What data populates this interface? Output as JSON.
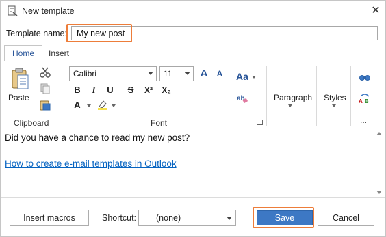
{
  "window": {
    "title": "New template",
    "close_glyph": "✕"
  },
  "template_name": {
    "label": "Template name:",
    "value": "My new post"
  },
  "tabs": [
    {
      "label": "Home",
      "active": true
    },
    {
      "label": "Insert",
      "active": false
    }
  ],
  "ribbon": {
    "clipboard": {
      "paste_label": "Paste",
      "group_label": "Clipboard"
    },
    "font": {
      "font_name": "Calibri",
      "font_size": "11",
      "group_label": "Font",
      "bold": "B",
      "italic": "I",
      "underline": "U",
      "strike": "S",
      "superscript": "X²",
      "subscript": "X₂",
      "font_color_glyph": "A",
      "case_glyph": "Aa",
      "grow_glyph": "A",
      "shrink_glyph": "A"
    },
    "paragraph": {
      "label": "Paragraph"
    },
    "styles": {
      "label": "Styles"
    },
    "more": {
      "label": "..."
    }
  },
  "editor": {
    "text": "Did you have a chance to read my new post?",
    "link_text": "How to create e-mail templates in Outlook"
  },
  "footer": {
    "insert_macros": "Insert macros",
    "shortcut_label": "Shortcut:",
    "shortcut_value": "(none)",
    "save": "Save",
    "cancel": "Cancel"
  },
  "colors": {
    "accent": "#2b579a",
    "save_bg": "#3d78c4",
    "highlight": "#ed7d3a",
    "link": "#0563c1"
  }
}
